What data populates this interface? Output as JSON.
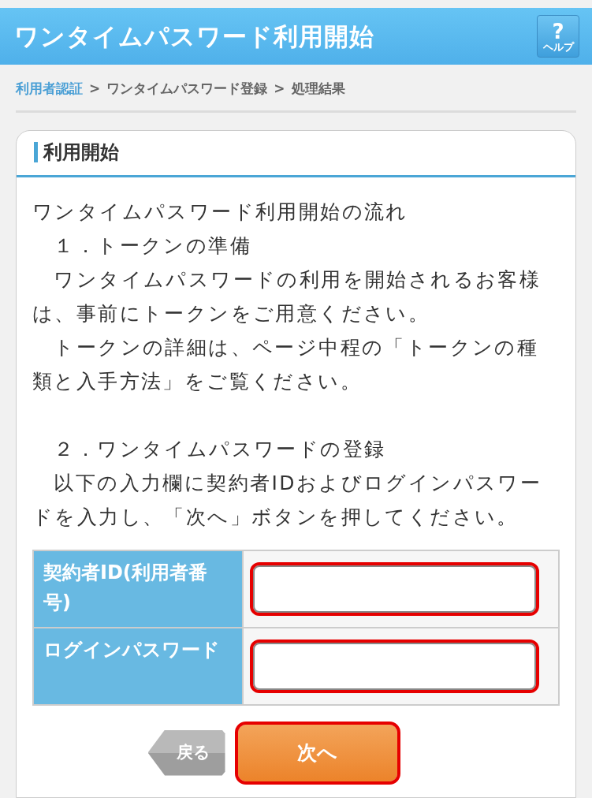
{
  "header": {
    "title": "ワンタイムパスワード利用開始",
    "help_button": {
      "label": "ヘルプ",
      "symbol": "?"
    }
  },
  "breadcrumb": [
    {
      "label": "利用者認証",
      "kind": "link"
    },
    {
      "label": ">",
      "kind": "sep"
    },
    {
      "label": "ワンタイムパスワード登録",
      "kind": "text"
    },
    {
      "label": ">",
      "kind": "sep"
    },
    {
      "label": "処理結果",
      "kind": "text"
    }
  ],
  "card": {
    "title": "利用開始",
    "sections": [
      {
        "paragraphs": [
          "ワンタイムパスワード利用開始の流れ",
          "　１．トークンの準備",
          "　ワンタイムパスワードの利用を開始されるお客様は、事前にトークンをご用意ください。",
          "　トークンの詳細は、ページ中程の「トークンの種類と入手方法」をご覧ください。"
        ]
      },
      {
        "paragraphs": [
          "　２．ワンタイムパスワードの登録",
          "　以下の入力欄に契約者IDおよびログインパスワードを入力し、「次へ」ボタンを押してください。"
        ]
      }
    ],
    "form": [
      {
        "label": "契約者ID(利用者番号)",
        "highlighted": true
      },
      {
        "label": "ログインパスワード",
        "highlighted": true
      }
    ],
    "buttons": [
      {
        "label": "戻る",
        "kind": "back",
        "highlighted": false
      },
      {
        "label": "次へ",
        "kind": "next",
        "highlighted": true
      }
    ]
  }
}
